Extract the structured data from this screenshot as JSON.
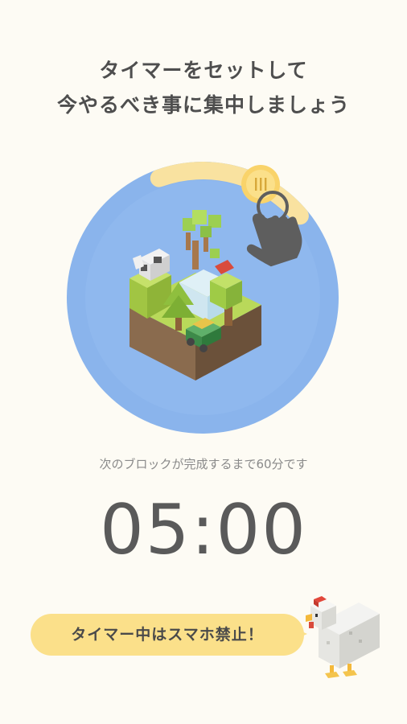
{
  "headline": {
    "line1": "タイマーをセットして",
    "line2": "今やるべき事に集中しましょう"
  },
  "dial": {
    "handle_icon": "grip-lines-icon",
    "gesture_icon": "tap-hand-icon",
    "illustration": "voxel-island-icon",
    "progress_fraction": 0.083,
    "colors": {
      "ring": "#8ab4ec",
      "track": "#f9e2a0",
      "inner": "#8fb8ee"
    }
  },
  "subtext": "次のブロックが完成するまで60分です",
  "timer": "05:00",
  "warning": {
    "text": "タイマー中はスマホ禁止！",
    "mascot": "voxel-chicken-icon"
  }
}
